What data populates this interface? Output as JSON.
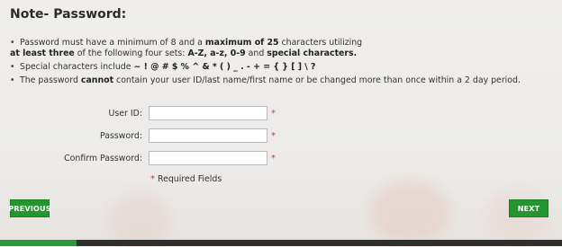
{
  "title": "Note- Password:",
  "rules": {
    "r1_a": "Password must have a minimum of 8 and a ",
    "r1_b": "maximum of 25",
    "r1_c": " characters utilizing",
    "r1_d": "at least three",
    "r1_e": " of the following four sets: ",
    "r1_f": "A-Z, a-z, 0-9",
    "r1_g": " and ",
    "r1_h": "special characters.",
    "r2_a": "Special characters include ",
    "r2_b": "~ ! @ # $ % ^ & * ( ) _ . - + = { } [ ] \\ ?",
    "r3_a": "The password ",
    "r3_b": "cannot",
    "r3_c": " contain your user ID/last name/first name or be changed more than once within a 2 day period."
  },
  "form": {
    "user_id_label": "User ID:",
    "user_id_value": "",
    "password_label": "Password:",
    "password_value": "",
    "confirm_label": "Confirm Password:",
    "confirm_value": "",
    "required_mark": "*",
    "required_text": "Required Fields"
  },
  "nav": {
    "previous_label": "PREVIOUS",
    "next_label": "NEXT"
  },
  "colors": {
    "button_green": "#25962f",
    "required_red": "#d83a3a",
    "footer_dark": "#2f2f2f"
  }
}
